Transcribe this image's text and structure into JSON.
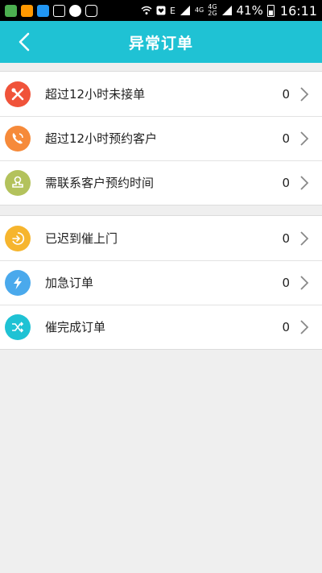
{
  "status_bar": {
    "signal_labels": [
      "E",
      "4G",
      "4G",
      "2G"
    ],
    "battery_percent": "41%",
    "time": "16:11"
  },
  "header": {
    "title": "异常订单",
    "background_color": "#1fc2d4"
  },
  "groups": [
    {
      "items": [
        {
          "label": "超过12小时未接单",
          "count": "0",
          "icon": "tools-icon",
          "icon_color": "#f0533a"
        },
        {
          "label": "超过12小时预约客户",
          "count": "0",
          "icon": "phone-icon",
          "icon_color": "#f68a3a"
        },
        {
          "label": "需联系客户预约时间",
          "count": "0",
          "icon": "stamp-icon",
          "icon_color": "#b3c25c"
        }
      ]
    },
    {
      "items": [
        {
          "label": "已迟到催上门",
          "count": "0",
          "icon": "enter-icon",
          "icon_color": "#f6b52e"
        },
        {
          "label": "加急订单",
          "count": "0",
          "icon": "lightning-icon",
          "icon_color": "#4aa9ec"
        },
        {
          "label": "催完成订单",
          "count": "0",
          "icon": "shuffle-icon",
          "icon_color": "#1fc2d4"
        }
      ]
    }
  ]
}
